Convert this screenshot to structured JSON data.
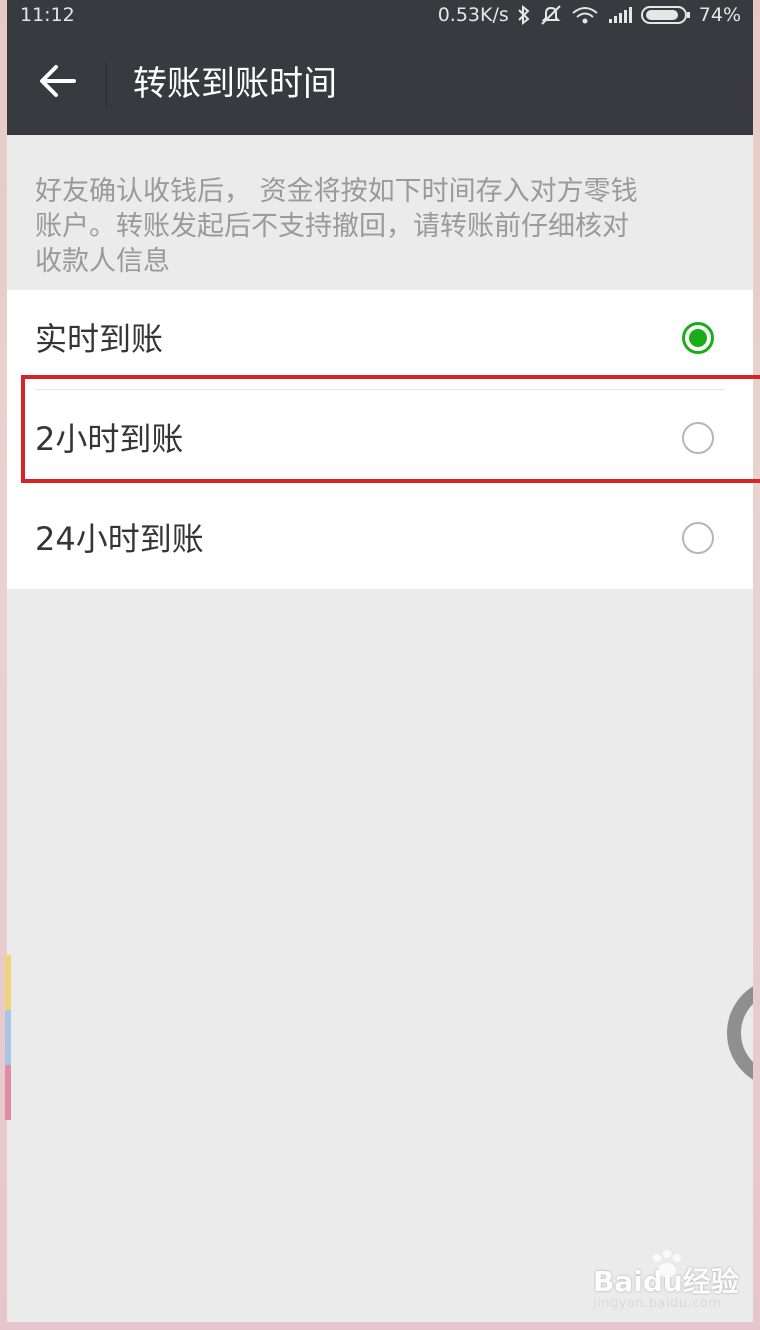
{
  "status_bar": {
    "time": "11:12",
    "network_speed": "0.53K/s",
    "battery_percent": "74%",
    "icons": [
      "bluetooth-icon",
      "mute-icon",
      "wifi-icon",
      "signal-icon",
      "battery-icon"
    ]
  },
  "toolbar": {
    "back_icon": "arrow-left-icon",
    "title": "转账到账时间"
  },
  "description": "好友确认收钱后， 资金将按如下时间存入对方零钱账户。转账发起后不支持撤回，请转账前仔细核对收款人信息",
  "options": [
    {
      "label": "实时到账",
      "selected": true
    },
    {
      "label": "2小时到账",
      "selected": false
    },
    {
      "label": "24小时到账",
      "selected": false
    }
  ],
  "watermark": {
    "brand": "Baidu经验",
    "url": "jingyan.baidu.com"
  },
  "colors": {
    "toolbar_bg": "#393a3f",
    "page_bg": "#ebebeb",
    "radio_selected": "#1aad19",
    "highlight_border": "#d9232b"
  }
}
